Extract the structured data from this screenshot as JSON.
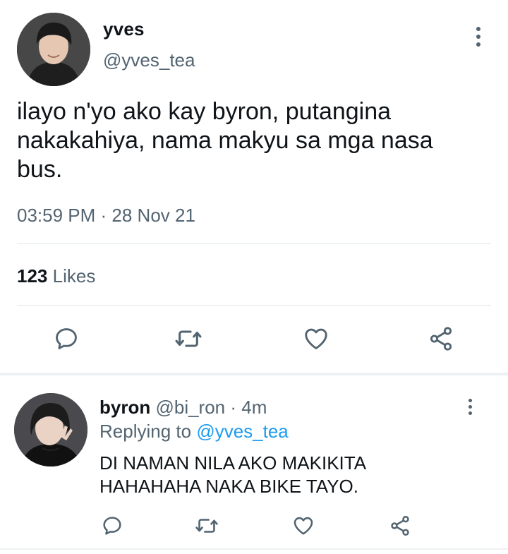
{
  "main_tweet": {
    "display_name": "yves",
    "handle": "@yves_tea",
    "text": "ilayo n'yo ako kay byron, putangina nakakahiya, nama makyu sa mga nasa bus.",
    "timestamp": "03:59 PM · 28 Nov 21",
    "likes_count": "123",
    "likes_label": "Likes"
  },
  "reply": {
    "display_name": "byron",
    "handle_time": "@bi_ron · 4m",
    "replying_prefix": "Replying to",
    "replying_to": "@yves_tea",
    "text": "DI NAMAN NILA AKO MAKIKITA HAHAHAHA NAKA BIKE TAYO."
  },
  "icons": {
    "reply": "reply-icon",
    "retweet": "retweet-icon",
    "like": "heart-icon",
    "share": "share-icon",
    "more": "more-icon"
  },
  "colors": {
    "text": "#0f1419",
    "secondary": "#536471",
    "link": "#1d9bf0",
    "icon": "#536471"
  }
}
